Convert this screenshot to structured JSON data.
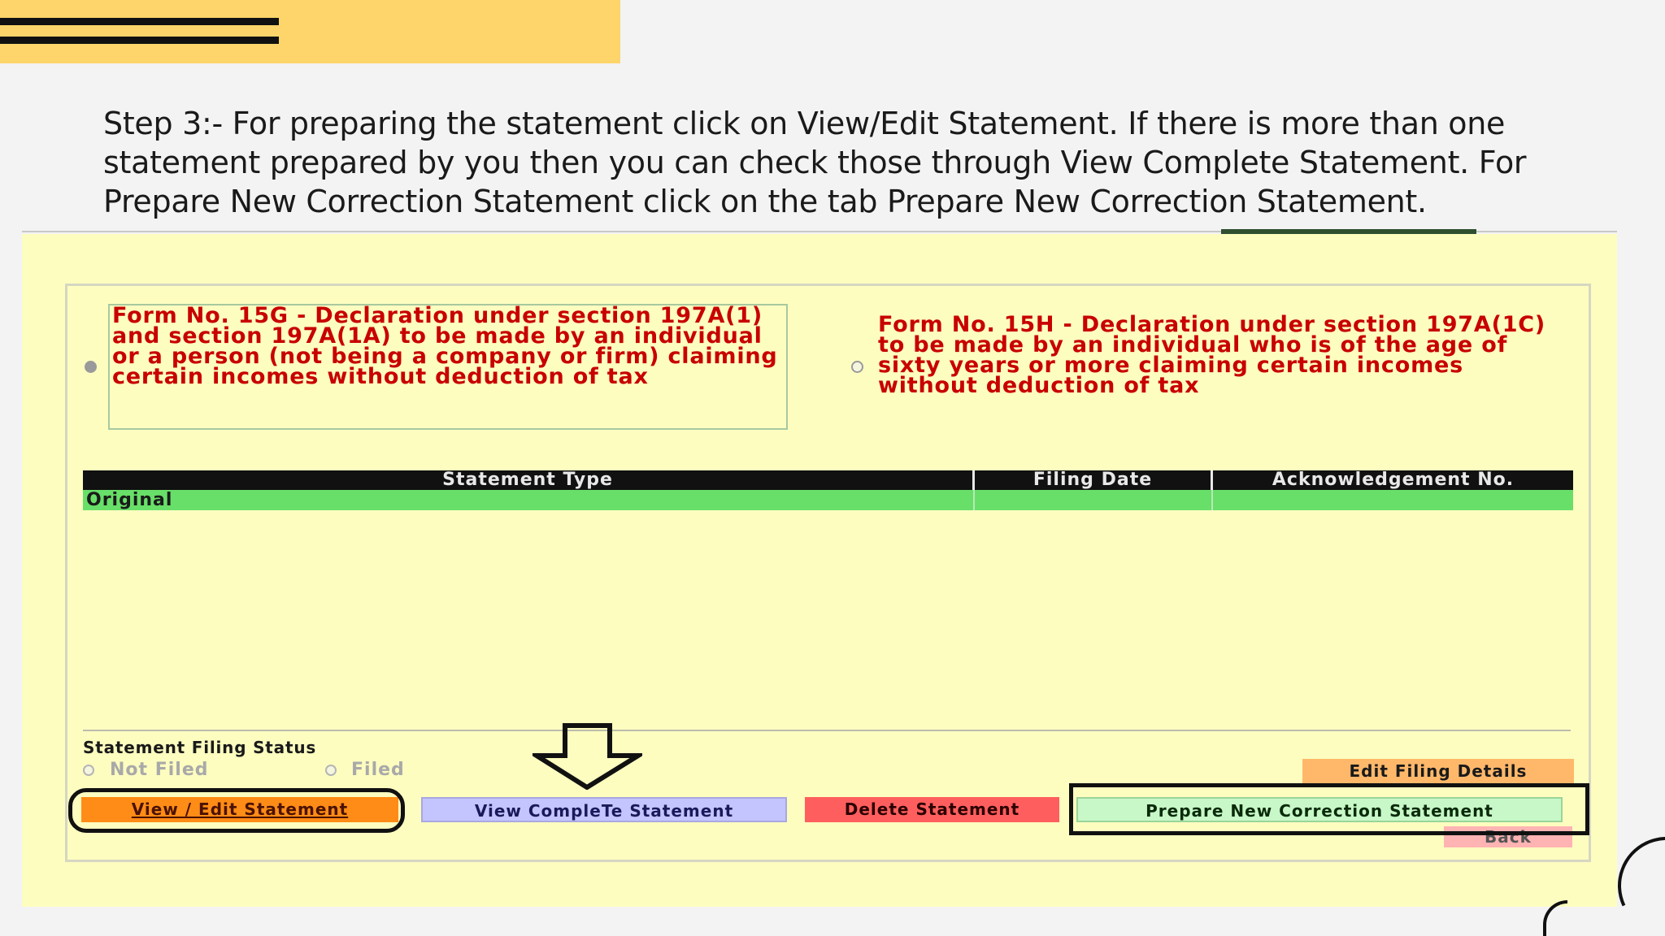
{
  "instructions": {
    "text": "Step 3:- For preparing the statement click on View/Edit Statement. If there is more than one statement prepared by you then you can check those through View Complete Statement. For Prepare New Correction Statement click on the tab Prepare New Correction Statement."
  },
  "form_options": {
    "form_15g": "Form No. 15G - Declaration under section 197A(1) and section 197A(1A) to be made by an individual or a person (not being a company or firm) claiming certain incomes without deduction of tax",
    "form_15h": "Form No. 15H - Declaration under section 197A(1C) to be made by an individual who is of the age of sixty years or more claiming certain incomes without deduction of tax",
    "selected": "form_15g"
  },
  "table": {
    "headers": {
      "statement_type": "Statement Type",
      "filing_date": "Filing Date",
      "ack_no": "Acknowledgement No."
    },
    "rows": [
      {
        "statement_type": "Original",
        "filing_date": "",
        "ack_no": ""
      }
    ]
  },
  "filing_status": {
    "label": "Statement Filing Status",
    "not_filed": "Not Filed",
    "filed": "Filed"
  },
  "buttons": {
    "view_edit": "View / Edit Statement",
    "view_complete": "View CompleTe Statement",
    "delete": "Delete Statement",
    "prepare_new": "Prepare New Correction Statement",
    "edit_filing": "Edit Filing Details",
    "back": "Back"
  },
  "colors": {
    "banner": "#fdd56a",
    "panel": "#fdfdc0",
    "form_text": "#c80000",
    "row_highlight": "#68df68"
  }
}
